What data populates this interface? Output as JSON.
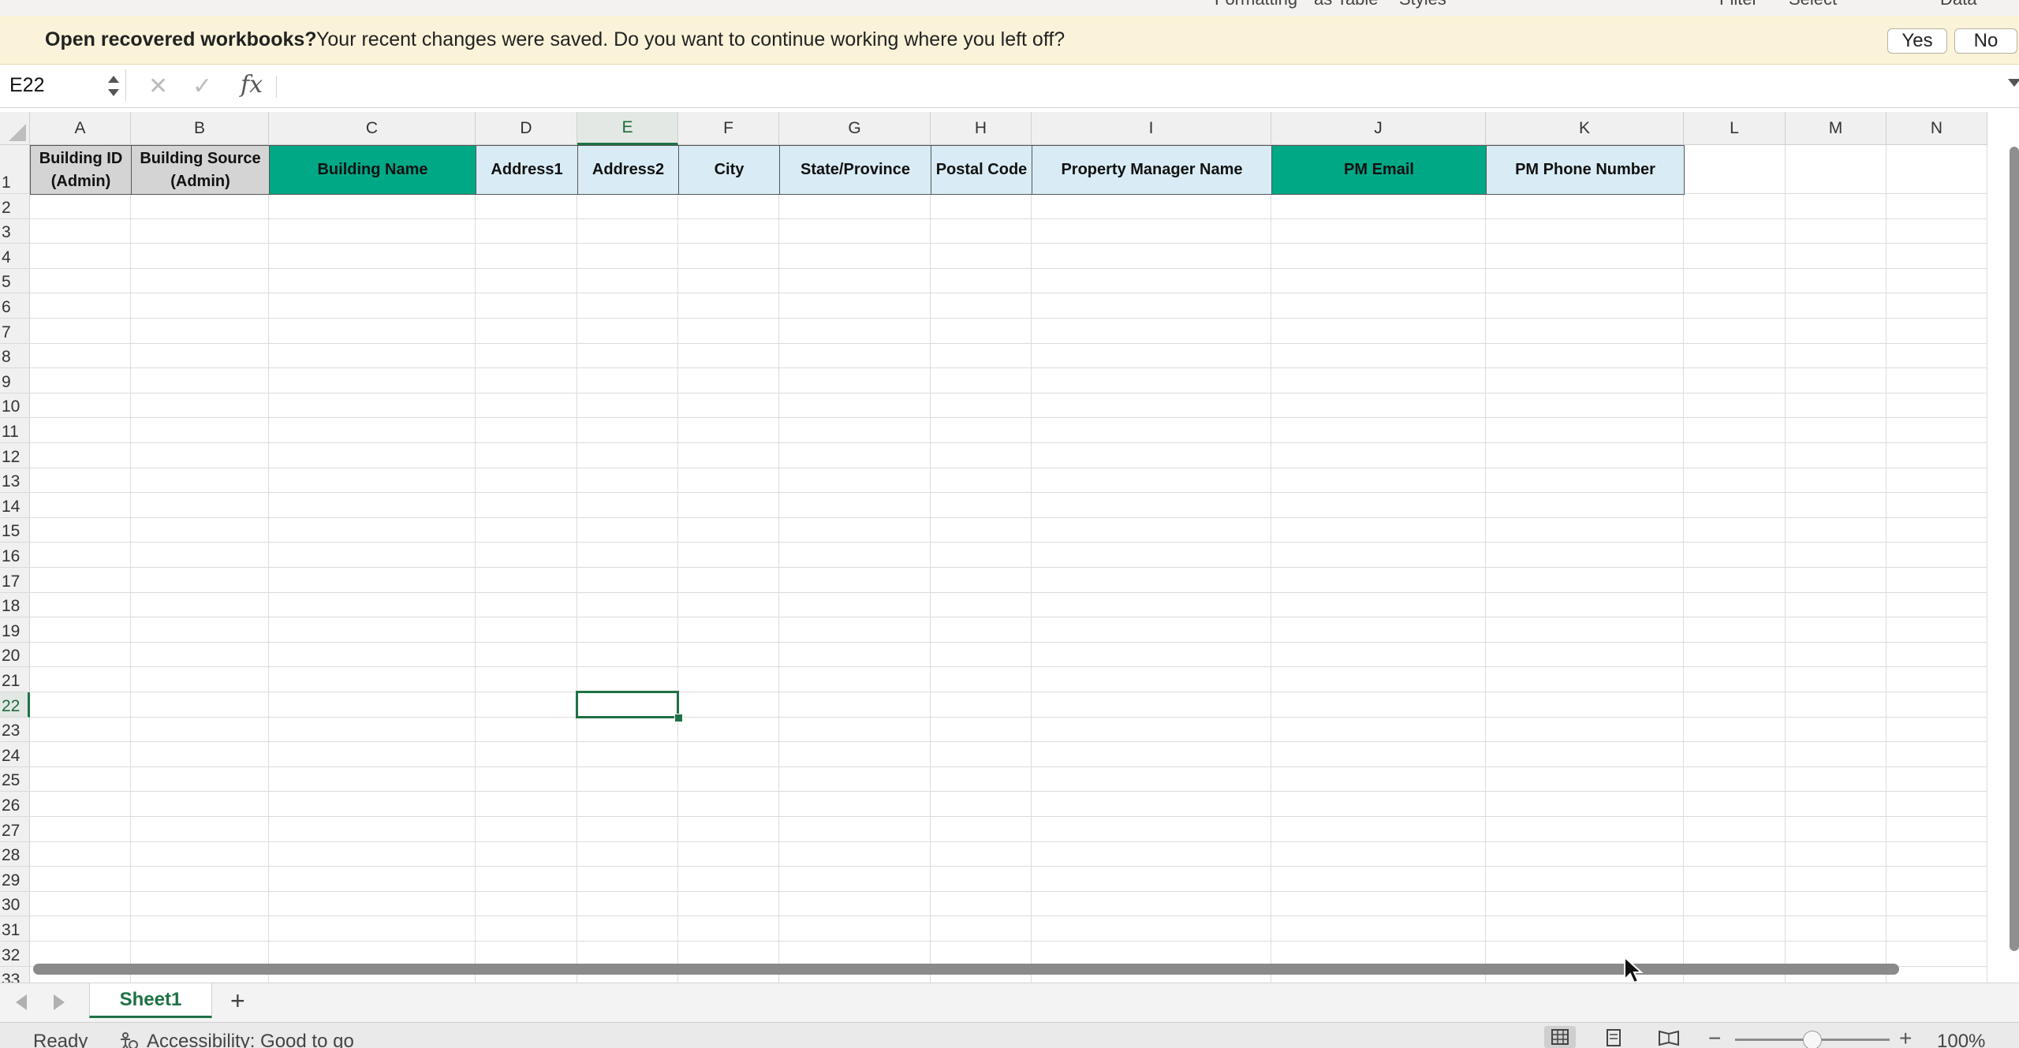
{
  "ribbon_fragments": [
    "Formatting",
    "as Table",
    "Styles",
    "Filter",
    "Select",
    "Data"
  ],
  "message_bar": {
    "title": "Open recovered workbooks?",
    "text": "Your recent changes were saved. Do you want to continue working where you left off?",
    "yes_label": "Yes",
    "no_label": "No",
    "background": "#fbf3d9"
  },
  "formula_bar": {
    "name_box": "E22",
    "formula": "",
    "cancel_icon": "close-icon",
    "enter_icon": "check-icon",
    "function_icon": "fx-icon",
    "fx_label": "fx"
  },
  "grid": {
    "columns": [
      "A",
      "B",
      "C",
      "D",
      "E",
      "F",
      "G",
      "H",
      "I",
      "J",
      "K",
      "L",
      "M",
      "N"
    ],
    "active_column": "E",
    "active_row": 22,
    "row_count": 32,
    "accent_color": "#1e7145",
    "header_row": [
      {
        "col": "A",
        "text": "Building ID (Admin)",
        "fill": "#d4d4d4"
      },
      {
        "col": "B",
        "text": "Building Source (Admin)",
        "fill": "#d4d4d4"
      },
      {
        "col": "C",
        "text": "Building Name",
        "fill": "#00a886"
      },
      {
        "col": "D",
        "text": "Address1",
        "fill": "#d9ecf5"
      },
      {
        "col": "E",
        "text": "Address2",
        "fill": "#d9ecf5"
      },
      {
        "col": "F",
        "text": "City",
        "fill": "#d9ecf5"
      },
      {
        "col": "G",
        "text": "State/Province",
        "fill": "#d9ecf5"
      },
      {
        "col": "H",
        "text": "Postal Code",
        "fill": "#d9ecf5"
      },
      {
        "col": "I",
        "text": "Property Manager Name",
        "fill": "#d9ecf5"
      },
      {
        "col": "J",
        "text": "PM Email",
        "fill": "#00a886"
      },
      {
        "col": "K",
        "text": "PM Phone Number",
        "fill": "#d9ecf5"
      }
    ]
  },
  "sheet_tabs": {
    "tabs": [
      "Sheet1"
    ],
    "active": "Sheet1",
    "add_label": "+"
  },
  "status_bar": {
    "ready": "Ready",
    "accessibility": "Accessibility: Good to go",
    "zoom": "100%",
    "zoom_fraction": 0.5
  }
}
